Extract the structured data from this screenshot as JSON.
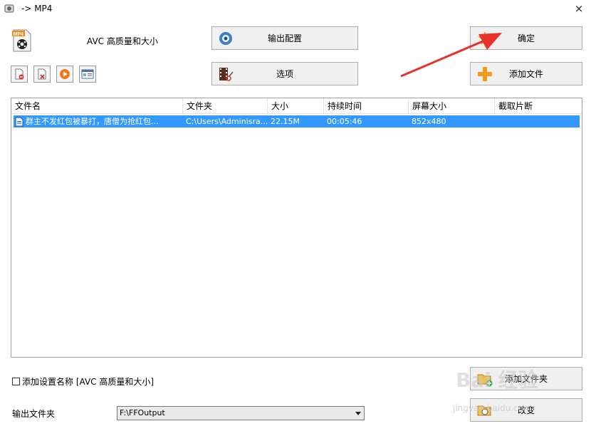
{
  "window": {
    "title": "-> MP4",
    "close": "×"
  },
  "profile": {
    "label": "AVC 高质量和大小"
  },
  "buttons": {
    "output_config": "输出配置",
    "ok": "确定",
    "options": "选项",
    "add_file": "添加文件",
    "add_folder": "添加文件夹",
    "change": "改变"
  },
  "toolbar": {
    "icons": [
      "remove-icon",
      "clear-icon",
      "play-icon",
      "info-icon"
    ]
  },
  "file_list": {
    "columns": [
      "文件名",
      "文件夹",
      "大小",
      "持续时间",
      "屏幕大小",
      "截取片断"
    ],
    "rows": [
      {
        "name": "群主不发红包被暴打，唐僧为抢红包...",
        "folder": "C:\\Users\\Adminisra...",
        "size": "22.15M",
        "duration": "00:05:46",
        "resolution": "852x480",
        "clip": ""
      }
    ]
  },
  "add_setting_name": {
    "label": "添加设置名称 [AVC 高质量和大小]",
    "checked": false
  },
  "output_folder": {
    "label": "输出文件夹",
    "value": "F:\\FFOutput"
  },
  "watermark": {
    "text": "Bai 经验",
    "sub": "jingyan.baidu.com"
  },
  "colors": {
    "selection": "#3399ff",
    "annotation_arrow": "#e8332a",
    "accent_orange": "#f39a1e"
  }
}
